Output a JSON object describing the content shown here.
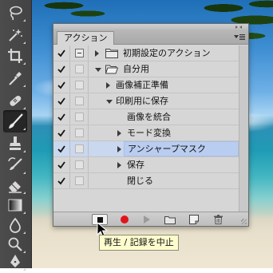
{
  "panel": {
    "tab_label": "アクション",
    "rows": [
      {
        "checked": true,
        "dialog": true,
        "indent": 1,
        "expander": "right",
        "folder": true,
        "label": "初期設定のアクション",
        "selected": false
      },
      {
        "checked": true,
        "dialog": false,
        "indent": 1,
        "expander": "down",
        "folder": true,
        "label": "自分用",
        "selected": false
      },
      {
        "checked": true,
        "dialog": false,
        "indent": 2,
        "expander": "right",
        "folder": false,
        "label": "画像補正準備",
        "selected": false
      },
      {
        "checked": true,
        "dialog": false,
        "indent": 2,
        "expander": "down",
        "folder": false,
        "label": "印刷用に保存",
        "selected": false
      },
      {
        "checked": true,
        "dialog": false,
        "indent": 3,
        "expander": "none",
        "folder": false,
        "label": "画像を統合",
        "selected": false
      },
      {
        "checked": true,
        "dialog": false,
        "indent": 3,
        "expander": "right",
        "folder": false,
        "label": "モード変換",
        "selected": false
      },
      {
        "checked": true,
        "dialog": false,
        "indent": 3,
        "expander": "right",
        "folder": false,
        "label": "アンシャープマスク",
        "selected": true
      },
      {
        "checked": true,
        "dialog": false,
        "indent": 3,
        "expander": "right",
        "folder": false,
        "label": "保存",
        "selected": false
      },
      {
        "checked": true,
        "dialog": false,
        "indent": 3,
        "expander": "none",
        "folder": false,
        "label": "閉じる",
        "selected": false
      }
    ],
    "bottom_buttons": [
      "stop",
      "record",
      "play",
      "new-set",
      "new-action",
      "delete"
    ]
  },
  "tooltip": {
    "text": "再生 / 記録を中止"
  },
  "tools": [
    "lasso",
    "quick-selection",
    "crop",
    "eyedropper",
    "healing-brush",
    "brush",
    "clone-stamp",
    "history-brush",
    "eraser",
    "gradient",
    "blur",
    "dodge",
    "pen"
  ],
  "colors": {
    "panel_bg": "#d6d6d6",
    "selection": "#b9cdf0",
    "record": "#e2141b",
    "tooltip_bg": "#fdfccd"
  }
}
